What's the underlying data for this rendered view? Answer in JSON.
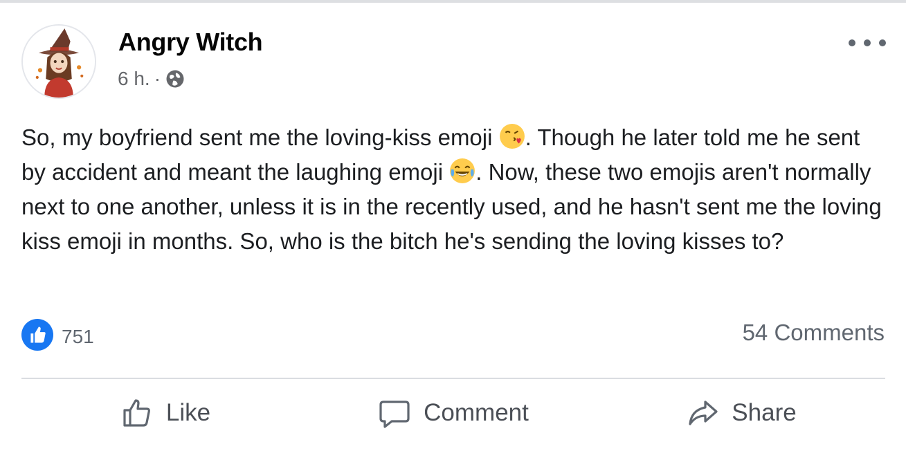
{
  "post": {
    "author": "Angry Witch",
    "timestamp": "6 h.",
    "separator": "·",
    "audience_icon": "globe-icon",
    "text_parts": [
      "So, my boyfriend sent me the loving-kiss emoji ",
      ". Though he later told me he sent by accident and meant the laughing emoji ",
      ". Now, these two emojis aren't normally next to one another, unless it is in the recently used, and he hasn't sent me the loving kiss emoji in months. So, who is the bitch he's sending the loving kisses to?"
    ],
    "emojis": [
      "face-blowing-kiss-emoji",
      "face-with-tears-of-joy-emoji"
    ]
  },
  "stats": {
    "like_count": "751",
    "comments_count": "54 Comments"
  },
  "actions": {
    "like_label": "Like",
    "comment_label": "Comment",
    "share_label": "Share"
  },
  "colors": {
    "like_blue": "#1877f2",
    "secondary_text": "#65676b",
    "divider": "#dadde1"
  }
}
